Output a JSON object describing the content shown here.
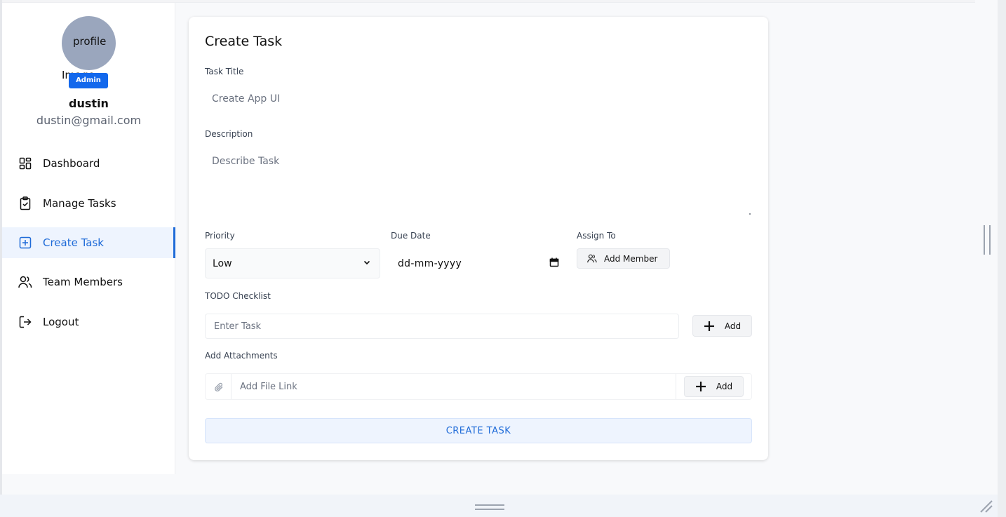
{
  "sidebar": {
    "avatar_alt_line1": "profile",
    "avatar_alt_line2": "Image",
    "role_badge": "Admin",
    "user_name": "dustin",
    "user_email": "dustin@gmail.com",
    "items": [
      {
        "label": "Dashboard",
        "icon": "dashboard-icon"
      },
      {
        "label": "Manage Tasks",
        "icon": "clipboard-check-icon"
      },
      {
        "label": "Create Task",
        "icon": "square-plus-icon",
        "active": true
      },
      {
        "label": "Team Members",
        "icon": "users-icon"
      },
      {
        "label": "Logout",
        "icon": "logout-icon"
      }
    ]
  },
  "form": {
    "title": "Create Task",
    "task_title_label": "Task Title",
    "task_title_placeholder": "Create App UI",
    "description_label": "Description",
    "description_placeholder": "Describe Task",
    "priority_label": "Priority",
    "priority_value": "Low",
    "due_date_label": "Due Date",
    "due_date_placeholder": "dd-mm-yyyy",
    "assign_to_label": "Assign To",
    "add_member_button": "Add Member",
    "todo_label": "TODO Checklist",
    "todo_placeholder": "Enter Task",
    "todo_add_button": "Add",
    "attachments_label": "Add Attachments",
    "attachment_placeholder": "Add File Link",
    "attachment_add_button": "Add",
    "submit_button": "CREATE TASK"
  },
  "colors": {
    "accent": "#1f6bd8",
    "badge": "#1368ec",
    "avatar": "#9aa6bd"
  }
}
